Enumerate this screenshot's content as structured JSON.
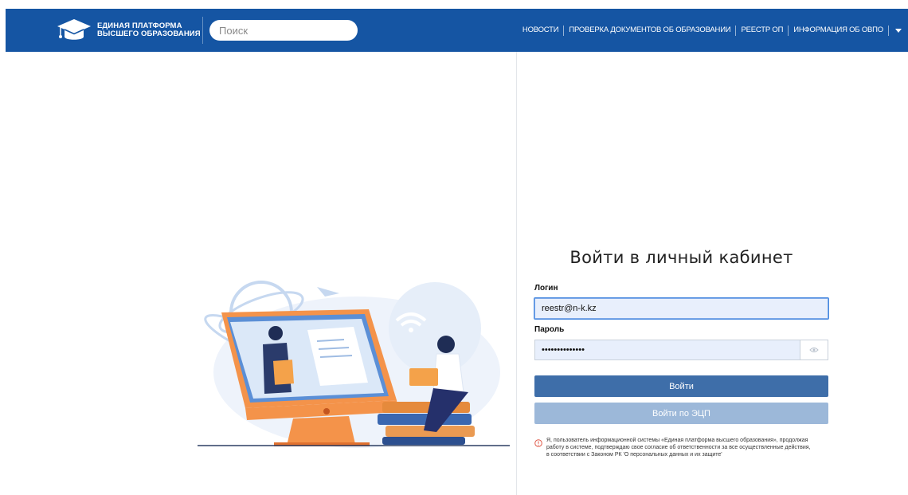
{
  "header": {
    "logo_line1": "ЕДИНАЯ ПЛАТФОРМА",
    "logo_line2": "ВЫСШЕГО ОБРАЗОВАНИЯ",
    "search_placeholder": "Поиск",
    "nav": [
      {
        "label": "НОВОСТИ"
      },
      {
        "label": "ПРОВЕРКА ДОКУМЕНТОВ ОБ ОБРАЗОВАНИИ"
      },
      {
        "label": "РЕЕСТР ОП"
      },
      {
        "label": "ИНФОРМАЦИЯ ОБ ОВПО"
      }
    ],
    "background": "#1555a3"
  },
  "login": {
    "title": "Войти в личный кабинет",
    "login_label": "Логин",
    "login_value": "reestr@n-k.kz",
    "password_label": "Пароль",
    "password_value": "••••••••••••••",
    "submit_label": "Войти",
    "ecp_label": "Войти по ЭЦП",
    "notice": "Я, пользователь информационной системы «Единая платформа высшего образования», продолжая работу в системе, подтверждаю свое согласие об ответственности за все осуществленные действия, в соответствии с Законом РК 'О персональных данных и их защите'"
  },
  "colors": {
    "primary_button": "#3e6ea9",
    "secondary_button": "#9cb8d9",
    "input_bg": "#e8effc",
    "notice_icon": "#e05a4a"
  },
  "icons": {
    "logo": "graduation-cap-icon",
    "eye": "eye-icon",
    "notice": "exclamation-circle-icon",
    "nav_more": "caret-down-icon"
  }
}
